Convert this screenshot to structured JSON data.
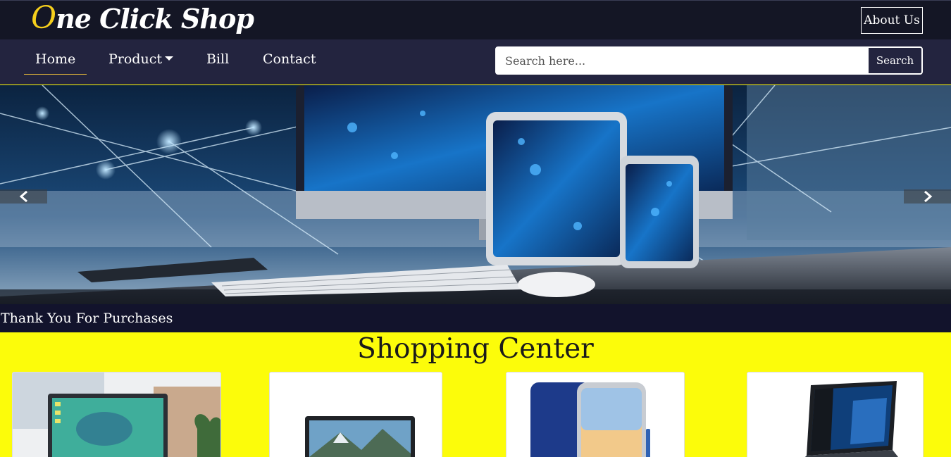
{
  "header": {
    "brand_first_letter": "O",
    "brand_rest": "ne Click Shop",
    "about_label": "About Us"
  },
  "nav": {
    "items": [
      {
        "label": "Home",
        "active": true
      },
      {
        "label": "Product",
        "dropdown": true
      },
      {
        "label": "Bill"
      },
      {
        "label": "Contact"
      }
    ],
    "search": {
      "placeholder": "Search here...",
      "value": "",
      "button_label": "Search"
    }
  },
  "carousel": {
    "caption": "Thank You For Purchases",
    "prev_icon": "chevron-left-icon",
    "next_icon": "chevron-right-icon"
  },
  "shopping": {
    "title": "Shopping Center",
    "products": [
      {
        "image": "laptop-photo"
      },
      {
        "image": "laptop-photo"
      },
      {
        "image": "smartphone-photo"
      },
      {
        "image": "laptop-photo"
      }
    ]
  },
  "colors": {
    "header_bg": "#141625",
    "nav_bg": "#23243f",
    "accent_yellow": "#f6cf1c",
    "page_bg": "#fcfc0a",
    "caption_bg": "#12132c"
  }
}
